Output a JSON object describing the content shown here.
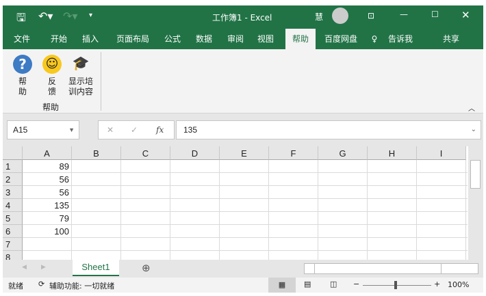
{
  "title": "工作簿1  -  Excel",
  "user_initial": "慧",
  "tabs": [
    "文件",
    "开始",
    "插入",
    "页面布局",
    "公式",
    "数据",
    "审阅",
    "视图",
    "帮助",
    "百度网盘",
    "告诉我",
    "共享"
  ],
  "ribbon": {
    "help": "帮\n助",
    "feedback": "反\n馈",
    "training": "显示培\n训内容",
    "group": "帮助"
  },
  "name_box": "A15",
  "formula": "135",
  "fx": "fx",
  "columns": [
    "A",
    "B",
    "C",
    "D",
    "E",
    "F",
    "G",
    "H",
    "I"
  ],
  "rows": [
    "1",
    "2",
    "3",
    "4",
    "5",
    "6",
    "7",
    "8"
  ],
  "values": [
    "89",
    "56",
    "56",
    "135",
    "79",
    "100"
  ],
  "sheet": "Sheet1",
  "status": {
    "ready": "就绪",
    "accessibility": "辅助功能: 一切就绪",
    "zoom": "100%"
  },
  "colors": {
    "accent": "#217346"
  }
}
